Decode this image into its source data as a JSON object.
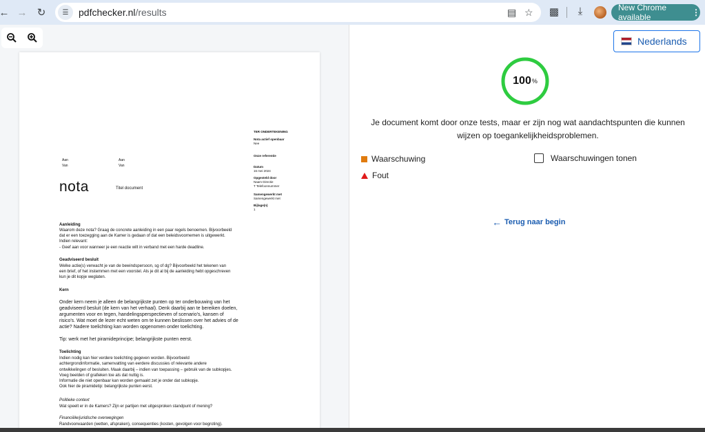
{
  "browser": {
    "url_domain": "pdfchecker.nl",
    "url_path": "/results",
    "update_label": "New Chrome available",
    "icons": {
      "back": "arrow-left-icon",
      "forward": "arrow-right-icon",
      "reload": "reload-icon",
      "site_info": "tune-icon",
      "translate": "translate-icon",
      "bookmark": "star-icon",
      "extensions": "puzzle-icon",
      "downloads": "download-icon",
      "profile": "avatar-icon",
      "menu": "kebab-icon"
    }
  },
  "viewer": {
    "zoom_out": "zoom-out-icon",
    "zoom_in": "zoom-in-icon"
  },
  "doc": {
    "meta": {
      "ter": "TER ONDERTEKENING",
      "nota_label": "Nota actief openbaar",
      "nota_val": "Nee",
      "ref_label": "Onze referentie",
      "datum_label": "Datum",
      "datum_val": "16 mei 2024",
      "opgesteld_label": "Opgesteld door",
      "opgesteld_val1": "Naam Directie",
      "opgesteld_val2": "T Telefoonnummer",
      "samen_label": "Samengewerkt met",
      "samen_val": "Samengewerkt met",
      "bijlage_label": "Bijlage(n)",
      "bijlage_val": "1"
    },
    "aan1": "Aan",
    "van1": "Van",
    "aan2": "Aan",
    "van2": "Van",
    "nota": "nota",
    "titel": "Titel document",
    "sections": {
      "aanleiding_h": "Aanleiding",
      "aanleiding_1": "Waarom deze nota? Graag de concrete aanleiding in een paar regels benoemen. Bijvoorbeeld",
      "aanleiding_2": "dat er een toezegging aan de Kamer is gedaan of dat een beleidsvoornemen is uitgewerkt.",
      "aanleiding_3": "Indien relevant:",
      "aanleiding_4": "- Geef aan voor wanneer je een reactie wilt in verband met een harde deadline.",
      "besluit_h": "Geadviseerd besluit",
      "besluit_1": "Welke actie(s) verwacht je van de bewindspersoon, sg of dg? Bijvoorbeeld het tekenen van",
      "besluit_2": "een brief, of het instemmen met een voorstel. Als je dit al bij de aanleiding hebt opgeschreven",
      "besluit_3": "kun je dit kopje weglaten.",
      "kern_h": "Kern",
      "kern_1": "Onder kern neem je alleen de belangrijkste punten op ter onderbouwing van het",
      "kern_2": "geadviseerd besluit (de kern van het verhaal). Denk daarbij aan te bereiken doelen,",
      "kern_3": "argumenten voor en tegen, handelingsperspectieven of scenario's, kansen of",
      "kern_4": "risico's. Wat moet de lezer echt weten om te kunnen beslissen over het advies of de",
      "kern_5": "actie? Nadere toelichting kan worden opgenomen onder toelichting.",
      "tip": "Tip: werk met het piramideprincipe; belangrijkste punten eerst.",
      "toel_h": "Toelichting",
      "toel_1": " Indien nodig kan hier verdere toelichting gegeven worden. Bijvoorbeeld",
      "toel_2": "achtergrondinformatie, samenvatting van eerdere discussies of relevante andere",
      "toel_3": "ontwikkelingen of besluiten. Maak daarbij – indien van toepassing – gebruik van de subkopjes.",
      "toel_4": "Voeg beelden of grafieken toe als dat nuttig is.",
      "toel_5": "Informatie die niet openbaar kan worden gemaakt zet je onder dat subkopje.",
      "toel_6": "Ook hier de piramidetip: belangrijkste punten eerst.",
      "pol_h": "Politieke context",
      "pol_1": "Wat speelt er in de Kamers? Zijn er partijen met uitgesproken standpunt of mening?",
      "fin_h": "Financiële/juridische overwegingen",
      "fin_1": "Randvoorwaarden (wetten, afspraken), consequenties (kosten, gevolgen voor begroting)."
    }
  },
  "results": {
    "language": "Nederlands",
    "score": 100,
    "score_value": "100",
    "score_unit": "%",
    "ring_color": "#2ecc40",
    "summary": "Je document komt door onze tests, maar er zijn nog wat aandachtspunten die kunnen wijzen op toegankelijkheidsproblemen.",
    "legend_warning": "Waarschuwing",
    "legend_error": "Fout",
    "show_warnings": "Waarschuwingen tonen",
    "back_label": "Terug naar begin",
    "warning_color": "#e07b0f",
    "error_color": "#e01b1b"
  }
}
